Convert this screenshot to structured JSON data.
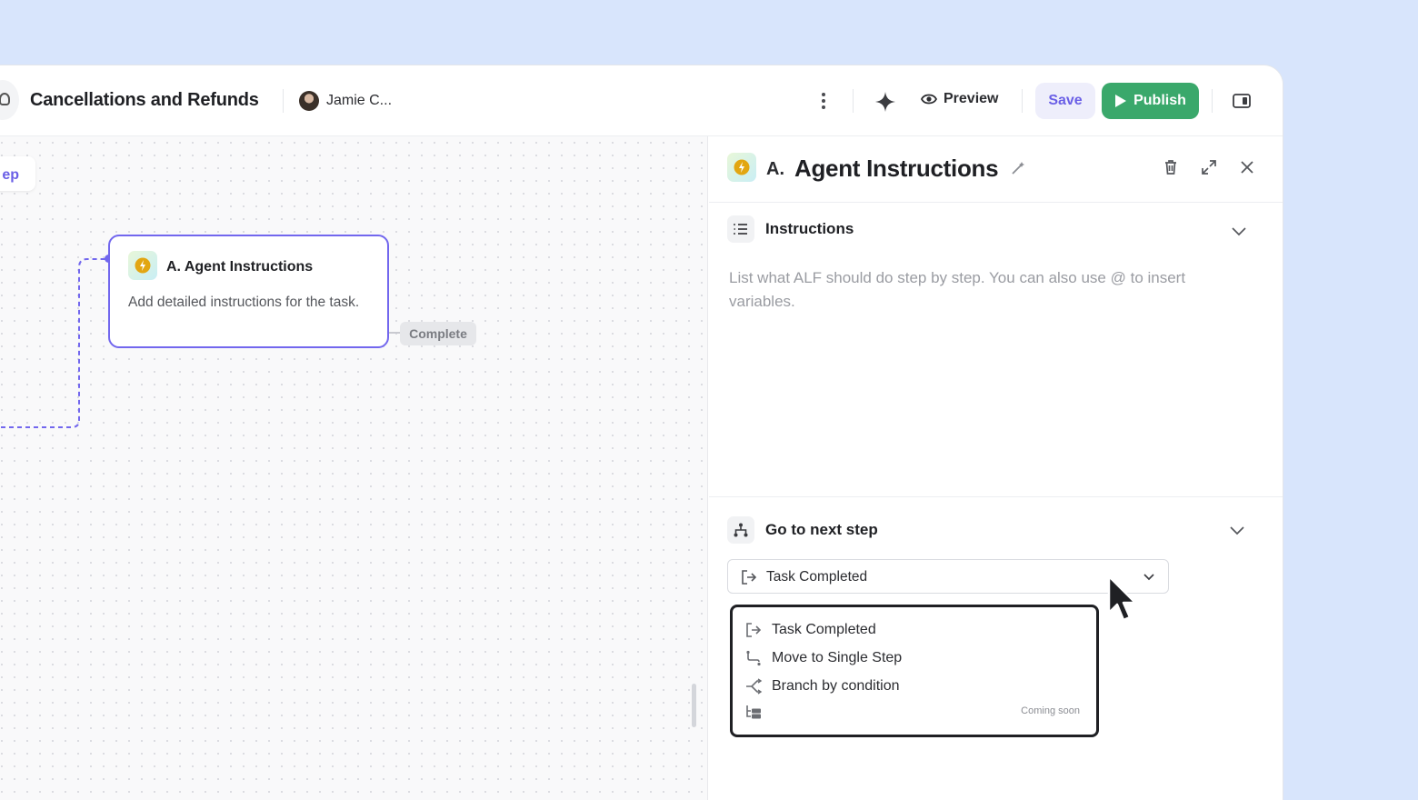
{
  "header": {
    "title": "Cancellations and Refunds",
    "user_name": "Jamie C...",
    "preview_label": "Preview",
    "save_label": "Save",
    "publish_label": "Publish"
  },
  "canvas": {
    "step_chip_label": "ep",
    "node": {
      "title": "A. Agent Instructions",
      "description": "Add detailed instructions for the task."
    },
    "complete_tag": "Complete"
  },
  "panel": {
    "prefix": "A.",
    "title": "Agent Instructions",
    "instructions": {
      "title": "Instructions",
      "placeholder": "List what ALF should do step by step. You can also use @ to insert variables."
    },
    "next_step": {
      "title": "Go to next step",
      "selected": "Task Completed",
      "options": [
        {
          "label": "Task Completed",
          "icon": "exit-icon"
        },
        {
          "label": "Move to Single Step",
          "icon": "step-path-icon"
        },
        {
          "label": "Branch by condition",
          "icon": "branch-icon"
        },
        {
          "label": "",
          "icon": "list-tree-icon",
          "note": "Coming soon"
        }
      ]
    }
  },
  "colors": {
    "accent": "#7267ee",
    "publish": "#3aa86b",
    "background": "#d8e5fc"
  }
}
